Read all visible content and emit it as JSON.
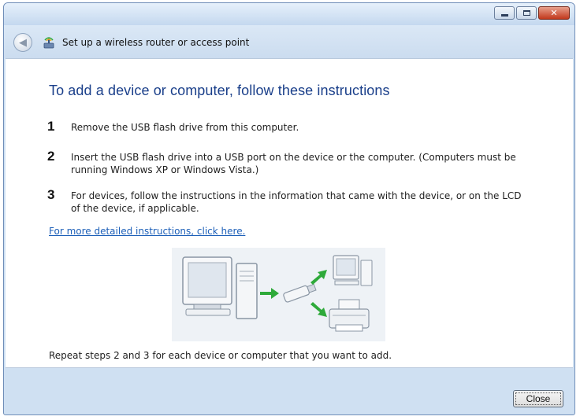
{
  "window": {
    "title": "Set up a wireless router or access point"
  },
  "main": {
    "heading": "To add a device or computer, follow these instructions",
    "steps": [
      {
        "number": "1",
        "text": "Remove the USB flash drive from this computer."
      },
      {
        "number": "2",
        "text": "Insert the USB flash drive into a USB port on the device or the computer. (Computers must be running Windows XP or Windows Vista.)"
      },
      {
        "number": "3",
        "text": "For devices, follow the instructions in the information that came with the device, or on the LCD of the device, if applicable."
      }
    ],
    "link": "For more detailed instructions, click here.",
    "footer_text": "Repeat steps 2 and 3 for each device or computer that you want to add."
  },
  "buttons": {
    "close": "Close"
  },
  "icons": {
    "back": "back-arrow-icon",
    "wireless": "wireless-network-icon",
    "minimize": "minimize-icon",
    "maximize": "maximize-icon",
    "close": "close-icon"
  },
  "colors": {
    "heading": "#1a3f8a",
    "link": "#1c5fb8",
    "arrow": "#2eaa3a",
    "chrome": "#cfe0f2"
  }
}
